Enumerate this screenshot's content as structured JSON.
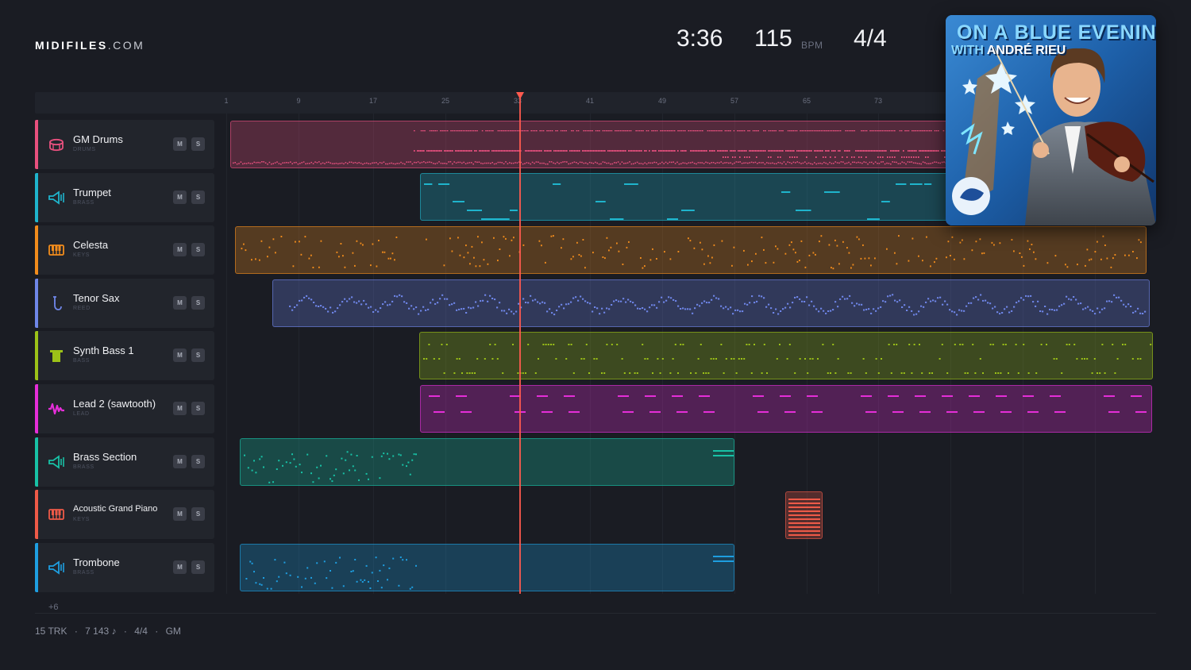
{
  "brand": {
    "name": "MIDIFILES",
    "domain": ".COM"
  },
  "transport": {
    "time": "3:36",
    "bpm": "115",
    "bpm_unit": "BPM",
    "meter": "4/4"
  },
  "ruler": {
    "ticks": [
      "1",
      "9",
      "17",
      "25",
      "33",
      "41",
      "49",
      "57",
      "65",
      "73"
    ]
  },
  "tracks": [
    {
      "name": "GM Drums",
      "category": "DRUMS",
      "color": "#e8507e",
      "icon": "drum-icon",
      "mute": "M",
      "solo": "S"
    },
    {
      "name": "Trumpet",
      "category": "BRASS",
      "color": "#1fb4cc",
      "icon": "horn-icon",
      "mute": "M",
      "solo": "S"
    },
    {
      "name": "Celesta",
      "category": "KEYS",
      "color": "#f28c1c",
      "icon": "keyboard-icon",
      "mute": "M",
      "solo": "S"
    },
    {
      "name": "Tenor Sax",
      "category": "REED",
      "color": "#6f86e8",
      "icon": "sax-icon",
      "mute": "M",
      "solo": "S"
    },
    {
      "name": "Synth Bass 1",
      "category": "BASS",
      "color": "#9cc218",
      "icon": "bass-icon",
      "mute": "M",
      "solo": "S"
    },
    {
      "name": "Lead 2 (sawtooth)",
      "category": "LEAD",
      "color": "#e52ed8",
      "icon": "wave-icon",
      "mute": "M",
      "solo": "S"
    },
    {
      "name": "Brass Section",
      "category": "BRASS",
      "color": "#18c2a6",
      "icon": "horn-icon",
      "mute": "M",
      "solo": "S"
    },
    {
      "name": "Acoustic Grand Piano",
      "category": "KEYS",
      "color": "#ee5a48",
      "icon": "keyboard-icon",
      "mute": "M",
      "solo": "S"
    },
    {
      "name": "Trombone",
      "category": "BRASS",
      "color": "#1e9ee0",
      "icon": "horn-icon",
      "mute": "M",
      "solo": "S"
    }
  ],
  "more_tracks": "+6",
  "footer": {
    "tracks": "15 TRK",
    "notes": "7 143 ♪",
    "meter": "4/4",
    "standard": "GM",
    "sep": "·"
  },
  "album": {
    "line1": "ON A BLUE EVENING",
    "line2_with": "WITH",
    "line2_artist": "ANDRÉ RIEU"
  }
}
